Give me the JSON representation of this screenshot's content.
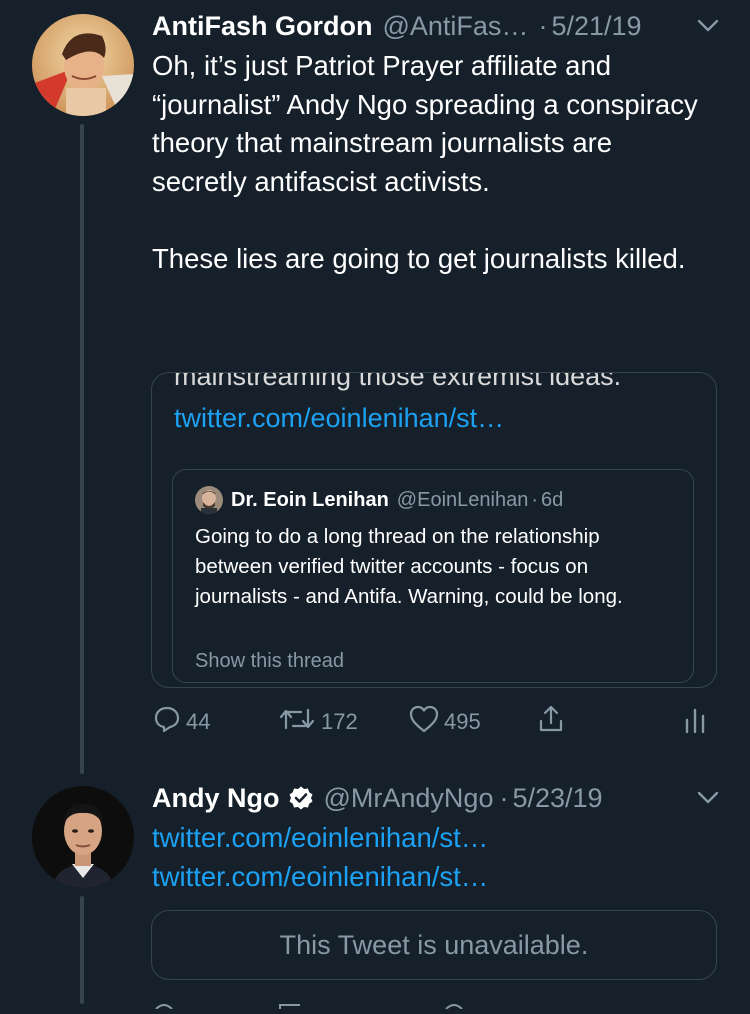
{
  "tweet1": {
    "name": "AntiFash Gordon",
    "handle": "@AntiFas…",
    "dot": "·",
    "date": "5/21/19",
    "text": "Oh, it’s just Patriot Prayer affiliate and “journalist” Andy Ngo spreading a conspiracy theory that mainstream journalists are secretly antifascist activists.\n\nThese lies are going to get journalists killed.",
    "quote": {
      "cut_text": "mainstreaming those extremist ideas.",
      "link": "twitter.com/eoinlenihan/st…",
      "inner": {
        "name": "Dr. Eoin Lenihan",
        "handle": "@EoinLenihan",
        "dot": "·",
        "time": "6d",
        "text": "Going to do a long thread on the relationship between verified twitter accounts - focus on journalists - and Antifa. Warning, could be long.",
        "show_thread": "Show this thread"
      }
    },
    "actions": {
      "replies": "44",
      "retweets": "172",
      "likes": "495"
    }
  },
  "tweet2": {
    "name": "Andy Ngo",
    "handle": "@MrAndyNgo",
    "dot": "·",
    "date": "5/23/19",
    "link1": "twitter.com/eoinlenihan/st…",
    "link2": "twitter.com/eoinlenihan/st…",
    "unavailable": "This Tweet is unavailable."
  },
  "colors": {
    "background": "#15202b",
    "border": "#38444d",
    "link": "#1da1f2",
    "secondary": "#8899a6"
  }
}
